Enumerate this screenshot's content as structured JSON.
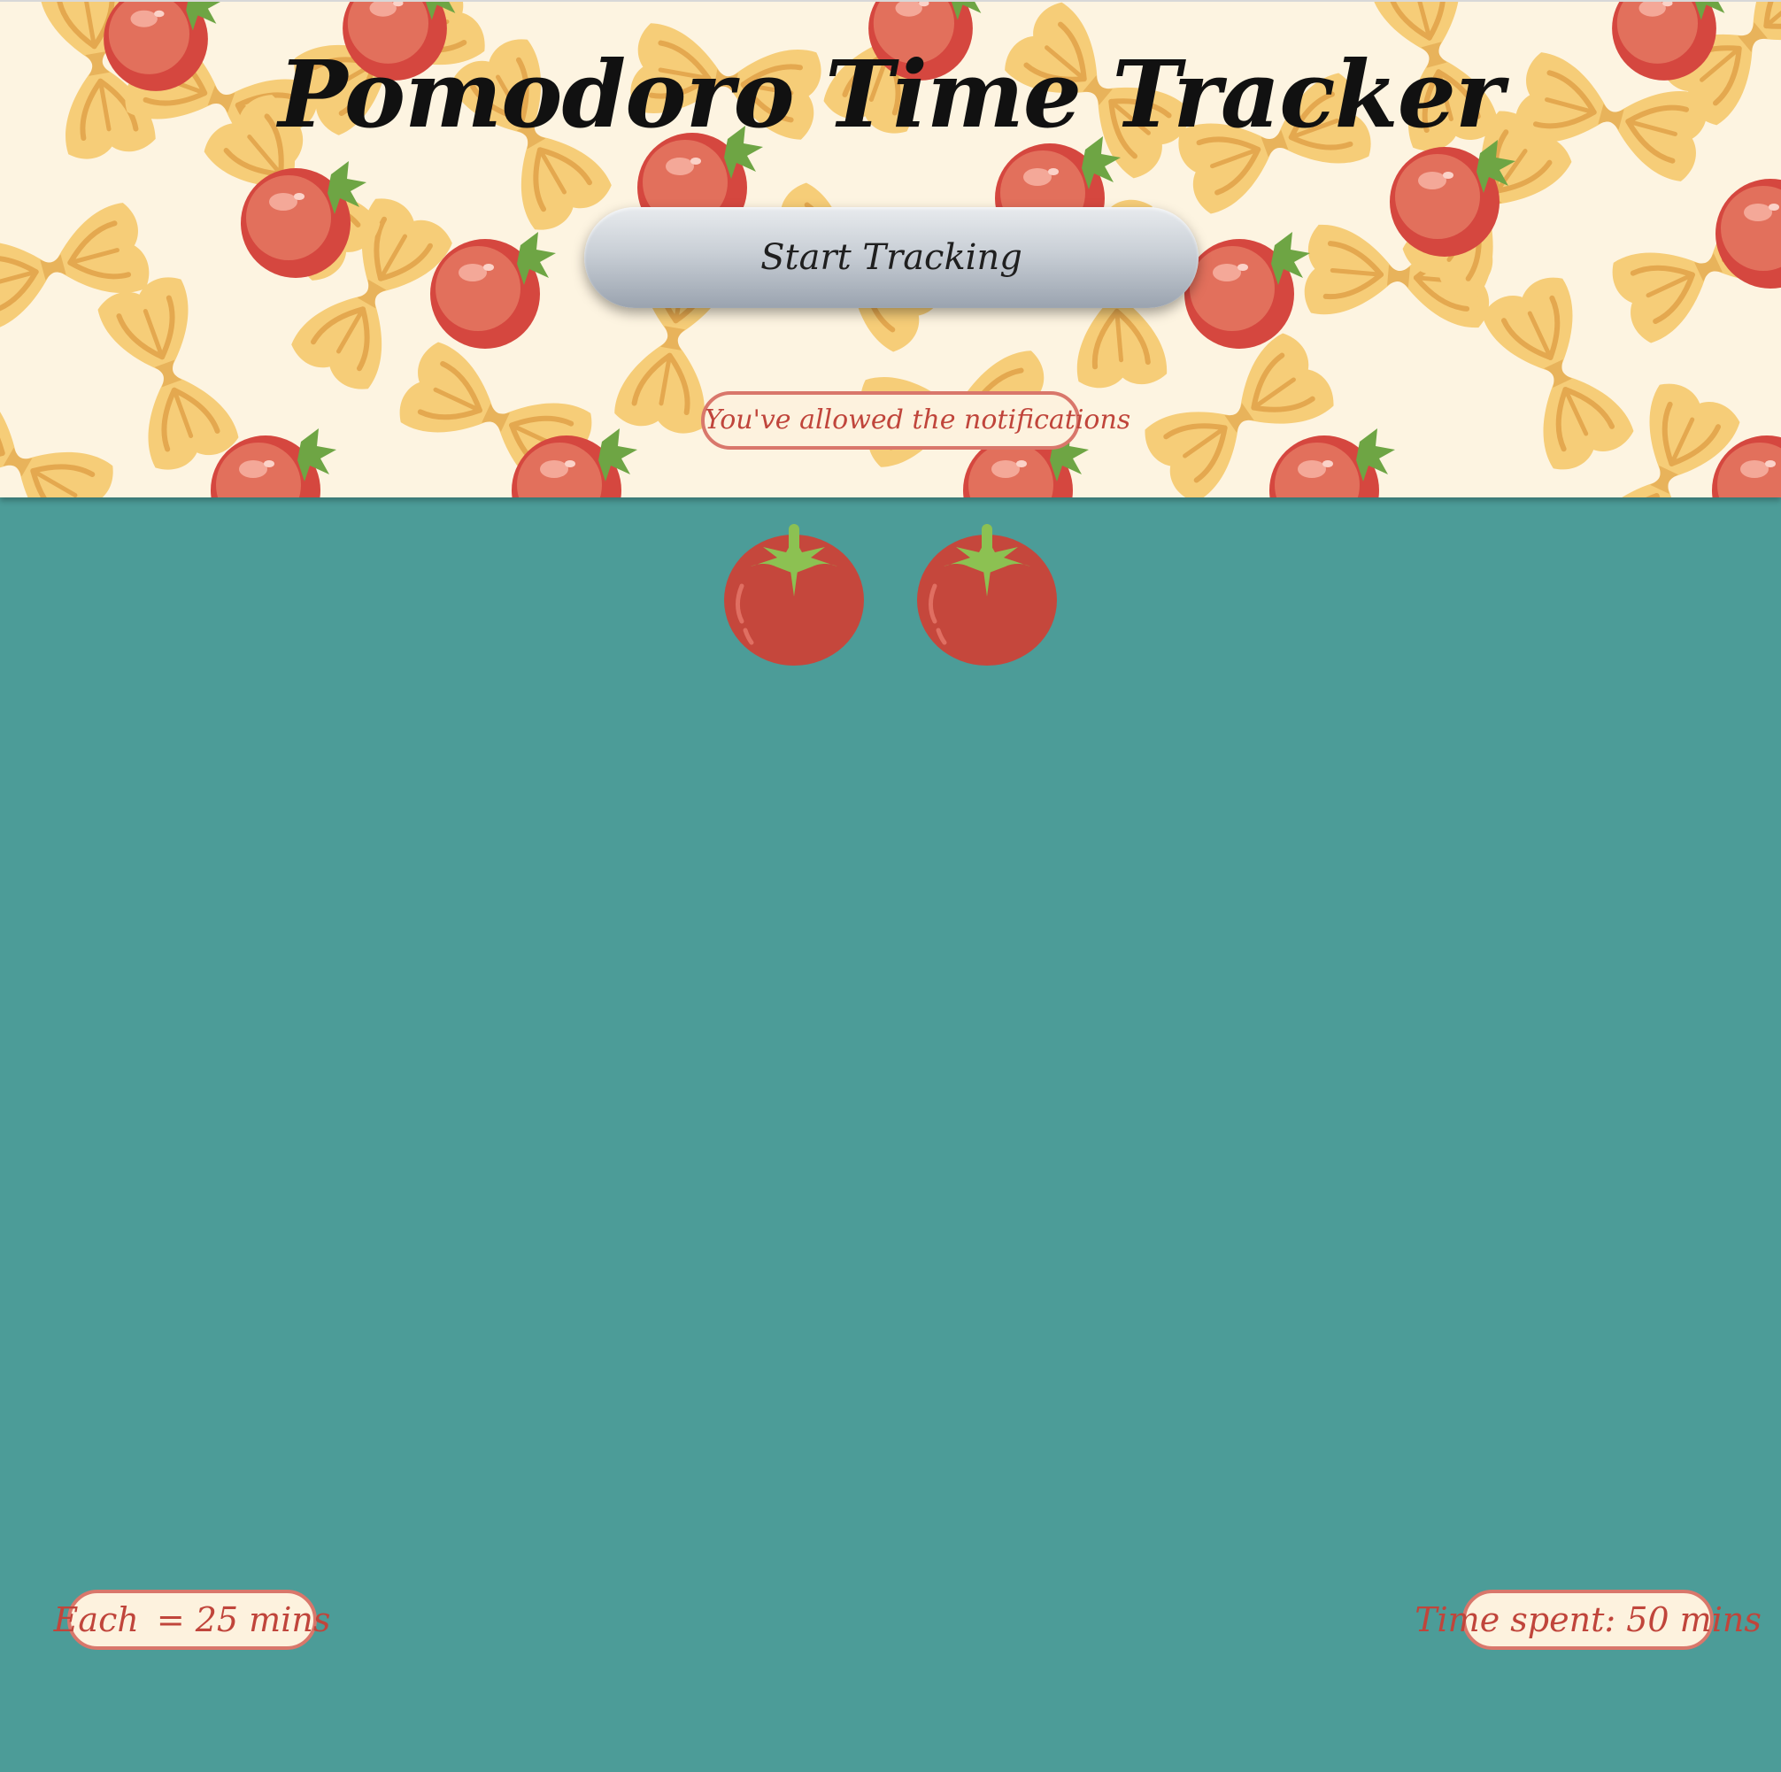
{
  "header": {
    "title": "Pomodoro Time Tracker",
    "start_button_label": "Start Tracking",
    "notification_status": "You've allowed the notifications"
  },
  "tracker": {
    "completed_pomodoros": 2
  },
  "footer": {
    "legend_prefix": "Each",
    "legend_suffix": "= 25 mins",
    "time_spent": "Time spent: 50 mins"
  },
  "icons": {
    "tomato": "tomato-icon"
  },
  "colors": {
    "background": "#4c9c98",
    "pasta": "#f6cd78",
    "pasta_dark": "#e2a84a",
    "tomato": "#c9473c",
    "leaf": "#8cc152",
    "pill_border": "#d9776b",
    "pill_text": "#c0453b",
    "pill_bg": "#fdf2de"
  }
}
